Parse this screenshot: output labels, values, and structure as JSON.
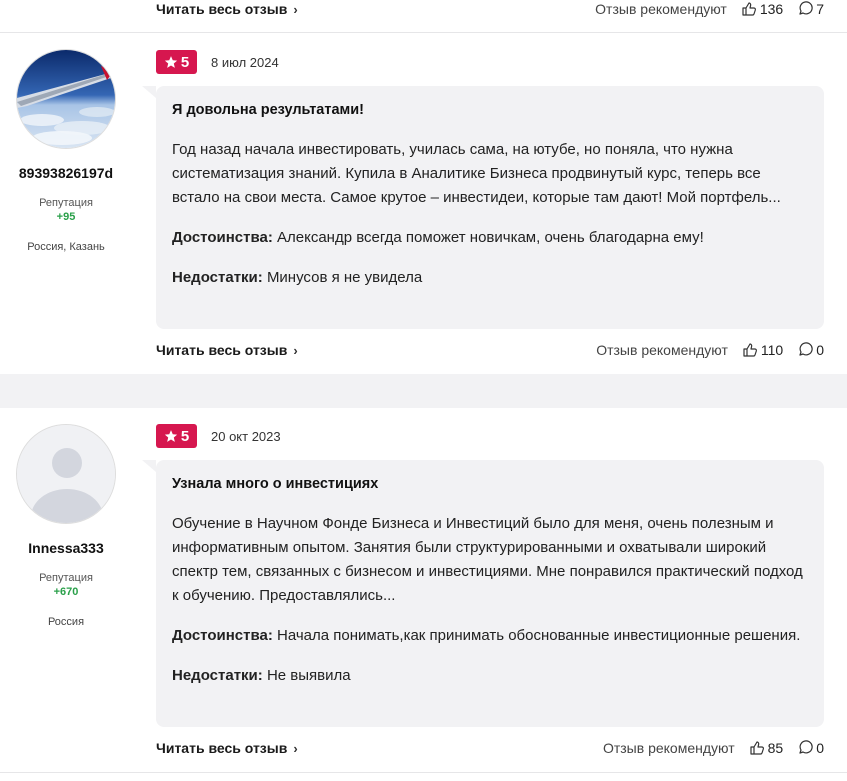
{
  "prev_footer": {
    "read_more": "Читать весь отзыв",
    "recommend": "Отзыв рекомендуют",
    "likes": "136",
    "comments": "7"
  },
  "reviews": [
    {
      "author": {
        "username": "89393826197d",
        "reputation_label": "Репутация",
        "reputation_value": "+95",
        "location": "Россия, Казань",
        "avatar": "airplane-wing-avatar"
      },
      "rating": "5",
      "date": "8 июл 2024",
      "title": "Я довольна результатами!",
      "text": "Год назад начала инвестировать, училась сама, на ютубе, но поняла, что нужна систематизация знаний. Купила в Аналитике Бизнеса продвинутый курс, теперь все встало на свои места. Самое крутое – инвестидеи, которые там дают! Мой портфель...",
      "pros_label": "Достоинства:",
      "pros": "Александр всегда поможет новичкам, очень благодарна ему!",
      "cons_label": "Недостатки:",
      "cons": "Минусов я не увидела",
      "footer": {
        "read_more": "Читать весь отзыв",
        "recommend": "Отзыв рекомендуют",
        "likes": "110",
        "comments": "0"
      }
    },
    {
      "author": {
        "username": "Innessa333",
        "reputation_label": "Репутация",
        "reputation_value": "+670",
        "location": "Россия",
        "avatar": "default-user-avatar"
      },
      "rating": "5",
      "date": "20 окт 2023",
      "title": "Узнала много о инвестициях",
      "text": "Обучение в Научном Фонде Бизнеса и Инвестиций было для меня, очень полезным и информативным опытом. Занятия были структурированными и охватывали широкий спектр тем, связанных с бизнесом и инвестициями. Мне понравился практический подход к обучению. Предоставлялись...",
      "pros_label": "Достоинства:",
      "pros": "Начала понимать,как принимать обоснованные инвестиционные решения.",
      "cons_label": "Недостатки:",
      "cons": "Не выявила",
      "footer": {
        "read_more": "Читать весь отзыв",
        "recommend": "Отзыв рекомендуют",
        "likes": "85",
        "comments": "0"
      }
    }
  ],
  "colors": {
    "rating_badge": "#d6174f",
    "reputation": "#2aa04a",
    "bubble_bg": "#f2f2f4"
  },
  "icons": [
    "star-icon",
    "thumbs-up-icon",
    "comment-icon",
    "chevron-right-icon"
  ]
}
